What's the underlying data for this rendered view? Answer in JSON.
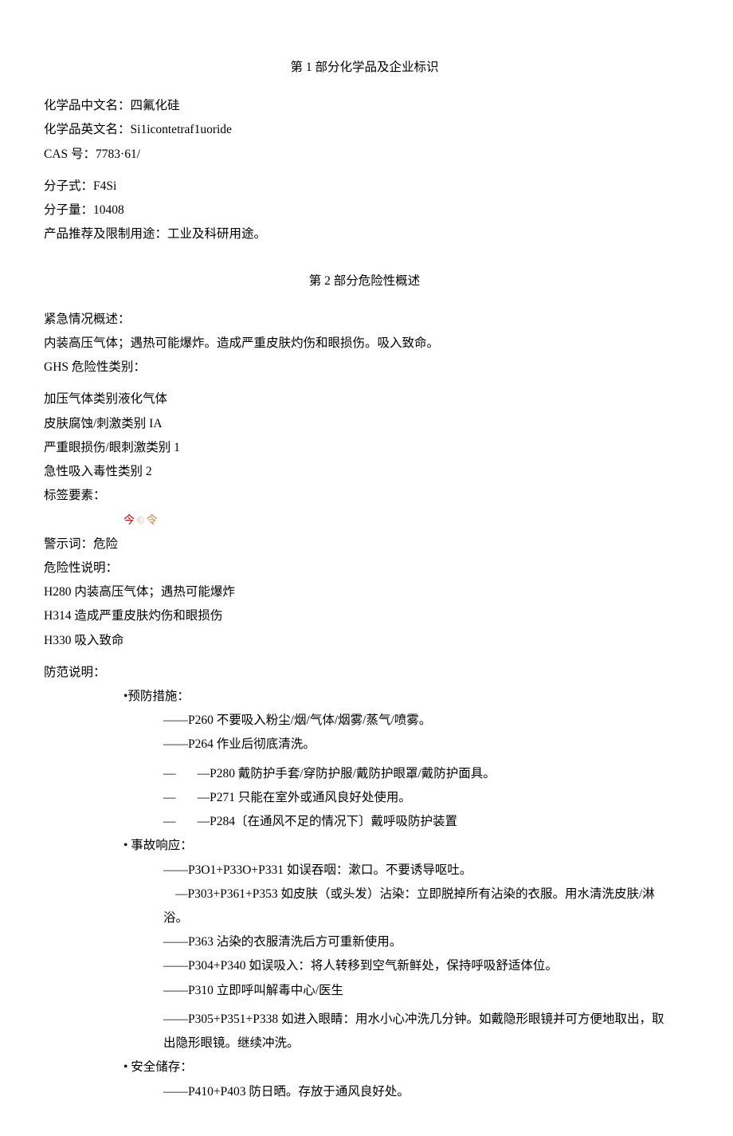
{
  "section1": {
    "title": "第 1 部分化学品及企业标识",
    "name_cn_label": "化学品中文名：",
    "name_cn": "四氟化硅",
    "name_en_label": "化学品英文名：",
    "name_en": "Si1icontetraf1uoride",
    "cas_label": "CAS 号：",
    "cas": "7783·61/",
    "formula_label": "分子式：",
    "formula": "F4Si",
    "mw_label": "分子量：",
    "mw": "10408",
    "use_label": "产品推荐及限制用途：",
    "use": "工业及科研用途。"
  },
  "section2": {
    "title": "第 2 部分危险性概述",
    "emergency_label": "紧急情况概述：",
    "emergency": "内装高压气体；遇热可能爆炸。造成严重皮肤灼伤和眼损伤。吸入致命。",
    "ghs_label": "GHS 危险性类别：",
    "ghs_items": [
      "加压气体类别液化气体",
      "皮肤腐蚀/刺激类别 IA",
      "严重眼损伤/眼刺激类别 1",
      "急性吸入毒性类别 2"
    ],
    "label_elements": "标签要素：",
    "picto1": "今",
    "picto2": "©",
    "picto3": "令",
    "signal_label": "警示词：",
    "signal": "危险",
    "hazard_label": "危险性说明：",
    "h_statements": [
      "H280 内装高压气体；遇热可能爆炸",
      "H314 造成严重皮肤灼伤和眼损伤",
      "H330 吸入致命"
    ],
    "precaution_label": "防范说明：",
    "prevention_label": "•预防措施：",
    "prevention_items": [
      "——P260 不要吸入粉尘/烟/气体/烟雾/蒸气/喷雾。",
      "——P264 作业后彻底清洗。"
    ],
    "prevention_items_dashed": [
      {
        "pre": "—",
        "gap": "",
        "txt": "—P280 戴防护手套/穿防护服/戴防护眼罩/戴防护面具。"
      },
      {
        "pre": "—",
        "gap": "",
        "txt": "—P271 只能在室外或通风良好处使用。"
      },
      {
        "pre": "—",
        "gap": "",
        "txt": "—P284〔在通风不足的情况下〕戴呼吸防护装置"
      }
    ],
    "response_label": "•    事故响应：",
    "response_items": [
      "——P3O1+P33O+P331 如误吞咽：漱口。不要诱导呕吐。"
    ],
    "response_item_303_pre": "—P303+P361+P353 如皮肤（或头发）沾染：立即脱掉所有沾染的衣服。用水清洗皮肤/淋",
    "response_item_303_cont": "浴。",
    "response_items2": [
      "——P363 沾染的衣服清洗后方可重新使用。",
      "——P304+P340 如误吸入：将人转移到空气新鲜处，保持呼吸舒适体位。",
      "——P310 立即呼叫解毒中心/医生"
    ],
    "response_item_305_a": "——P305+P351+P338 如进入眼睛：用水小心冲洗几分钟。如戴隐形眼镜并可方便地取出，取",
    "response_item_305_b": "出隐形眼镜。继续冲洗。",
    "storage_label": "•    安全储存：",
    "storage_item": "——P410+P403 防日晒。存放于通风良好处。"
  }
}
